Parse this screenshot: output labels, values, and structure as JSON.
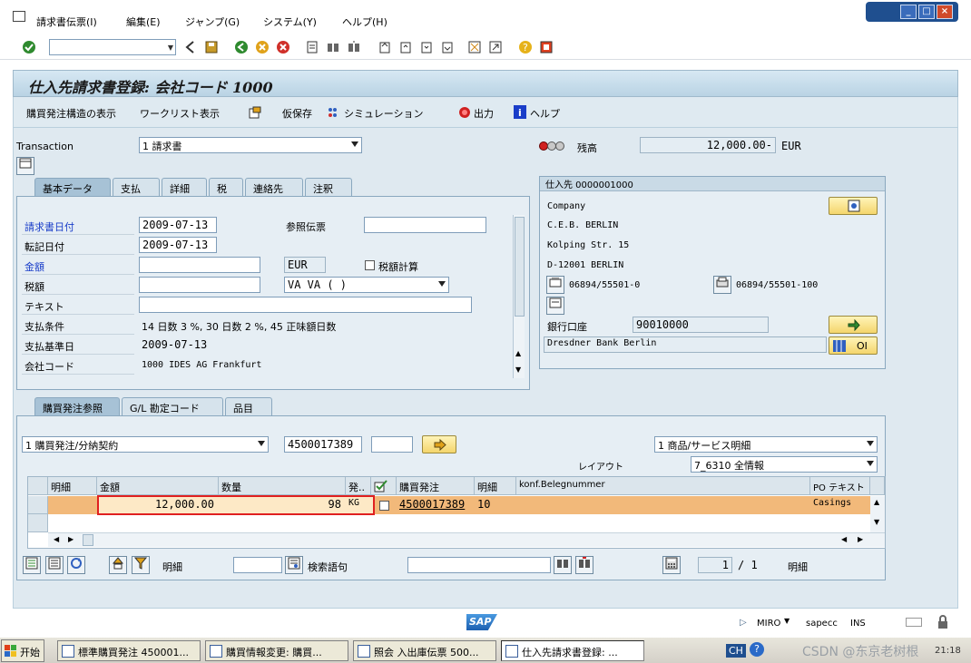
{
  "menu": {
    "items": [
      "請求書伝票(I)",
      "編集(E)",
      "ジャンプ(G)",
      "システム(Y)",
      "ヘルプ(H)"
    ]
  },
  "window_controls": [
    "_",
    "□",
    "×"
  ],
  "title": "仕入先請求書登録: 会社コード 1000",
  "app_toolbar": {
    "items": [
      "購買発注構造の表示",
      "ワークリスト表示",
      "仮保存",
      "シミュレーション",
      "出力",
      "ヘルプ"
    ]
  },
  "header": {
    "transaction_label": "Transaction",
    "transaction_value": "1 請求書",
    "balance_label": "残高",
    "balance_value": "12,000.00-",
    "balance_currency": "EUR"
  },
  "tabs_top": [
    "基本データ",
    "支払",
    "詳細",
    "税",
    "連絡先",
    "注釈"
  ],
  "basic_data": {
    "invoice_date_label": "請求書日付",
    "invoice_date": "2009-07-13",
    "reference_label": "参照伝票",
    "reference_value": "",
    "posting_date_label": "転記日付",
    "posting_date": "2009-07-13",
    "amount_label": "金額",
    "amount_value": "",
    "currency": "EUR",
    "calc_tax_label": "税額計算",
    "tax_label": "税額",
    "tax_value": "",
    "tax_code": "VA VA ( )",
    "text_label": "テキスト",
    "text_value": "",
    "payterm_label": "支払条件",
    "payterm_value": "14 日数 3 %, 30 日数 2 %, 45 正味額日数",
    "baseline_label": "支払基準日",
    "baseline_value": "2009-07-13",
    "company_label": "会社コード",
    "company_value": "1000 IDES AG Frankfurt"
  },
  "vendor": {
    "header": "仕入先 0000001000",
    "lines": [
      "Company",
      "C.E.B. BERLIN",
      "Kolping Str. 15",
      "D-12001 BERLIN"
    ],
    "phone": "06894/55501-0",
    "fax": "06894/55501-100",
    "bank_label": "銀行口座",
    "bank_account": "90010000",
    "bank_name": "Dresdner Bank Berlin",
    "oi_label": "OI"
  },
  "tabs_bottom": [
    "購買発注参照",
    "G/L 勘定コード",
    "品目"
  ],
  "po_ref": {
    "type_value": "1 購買発注/分納契約",
    "po_number": "4500017389",
    "extra_value": "",
    "layout_select": "1 商品/サービス明細",
    "layout_label": "レイアウト",
    "layout_value": "7_6310 全情報"
  },
  "grid": {
    "columns": [
      "明細",
      "金額",
      "数量",
      "発..",
      "",
      "購買発注",
      "明細",
      "konf.Belegnummer",
      "PO テキスト"
    ],
    "rows": [
      {
        "item": "",
        "amount": "12,000.00",
        "qty": "98",
        "unit": "KG",
        "po": "4500017389",
        "po_item": "10",
        "konf": "",
        "po_text": "Casings"
      }
    ]
  },
  "bottom_toolbar": {
    "item_label": "明細",
    "item_value": "",
    "search_label": "検索語句",
    "search_value": "",
    "page_value": "1",
    "page_total": "/ 1",
    "page_label": "明細"
  },
  "status": {
    "transaction": "MIRO",
    "system": "sapecc",
    "mode": "INS",
    "logo": "SAP"
  },
  "taskbar": {
    "start": "开始",
    "tasks": [
      "標準購買発注 450001...",
      "購買情報変更: 購買...",
      "照会 入出庫伝票 500...",
      "仕入先請求書登録: ..."
    ],
    "lang": "CH",
    "time": "21:18",
    "watermark": "CSDN @东京老树根"
  },
  "colors": {
    "accent_red": "#e02020",
    "row_highlight": "#f2b97a",
    "panel_bg": "#dfe9f0",
    "title_bg": "#c7dceb"
  }
}
